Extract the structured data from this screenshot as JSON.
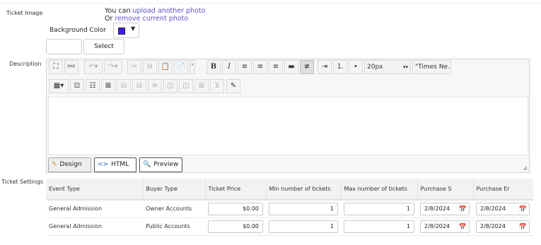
{
  "ticket_image": {
    "label": "Ticket Image",
    "line1_prefix": "You can ",
    "upload_link": "upload another photo",
    "line2_prefix": "Or ",
    "remove_link": "remove current photo"
  },
  "background_color": {
    "label": "Background Color",
    "swatch_color": "#3e1df0",
    "caret": "▼"
  },
  "file_picker": {
    "input_value": "",
    "select_label": "Select"
  },
  "description": {
    "label": "Description",
    "font_size_value": "20px",
    "font_family_value": "\"Times Ne...",
    "body": "",
    "modes": {
      "design": "Design",
      "html": "HTML",
      "preview": "Preview"
    },
    "icons": {
      "fullscreen": "fullscreen-icon",
      "find": "binoculars-icon",
      "undo": "undo-icon",
      "redo": "redo-icon",
      "cut": "cut-icon",
      "copy": "copy-icon",
      "paste": "paste-icon",
      "paste_special": "paste-special-icon",
      "bold": "B",
      "italic": "I",
      "align_left": "align-left-icon",
      "align_center": "align-center-icon",
      "align_right": "align-right-icon",
      "justify": "justify-icon",
      "strike": "strikethrough-icon",
      "indent": "indent-icon",
      "ordered_list": "ordered-list-icon",
      "bulleted_list": "bulleted-list-icon",
      "insert_table": "table-icon",
      "table_props": "table-properties-icon",
      "cell_props": "cell-properties-icon",
      "delete_table": "delete-table-icon",
      "insert_row_above": "insert-row-above-icon",
      "insert_row_below": "insert-row-below-icon",
      "delete_row": "delete-row-icon",
      "insert_col_left": "insert-column-left-icon",
      "insert_col_right": "insert-column-right-icon",
      "delete_col": "delete-column-icon",
      "merge_cells": "merge-cells-icon",
      "edit_cell": "edit-cell-icon"
    }
  },
  "ticket_settings": {
    "label": "Ticket Settings",
    "columns": [
      "Event Type",
      "Buyer Type",
      "Ticket Price",
      "Min number of tickets",
      "Max number of tickets",
      "Purchase S",
      "Purchase Er"
    ],
    "rows": [
      {
        "event_type": "General Admission",
        "buyer_type": "Owner Accounts",
        "price": "$0.00",
        "min": "1",
        "max": "1",
        "start": "2/8/2024",
        "end": "2/8/2024"
      },
      {
        "event_type": "General Admission",
        "buyer_type": "Public Accounts",
        "price": "$0.00",
        "min": "1",
        "max": "1",
        "start": "2/8/2024",
        "end": "2/8/2024"
      }
    ]
  }
}
